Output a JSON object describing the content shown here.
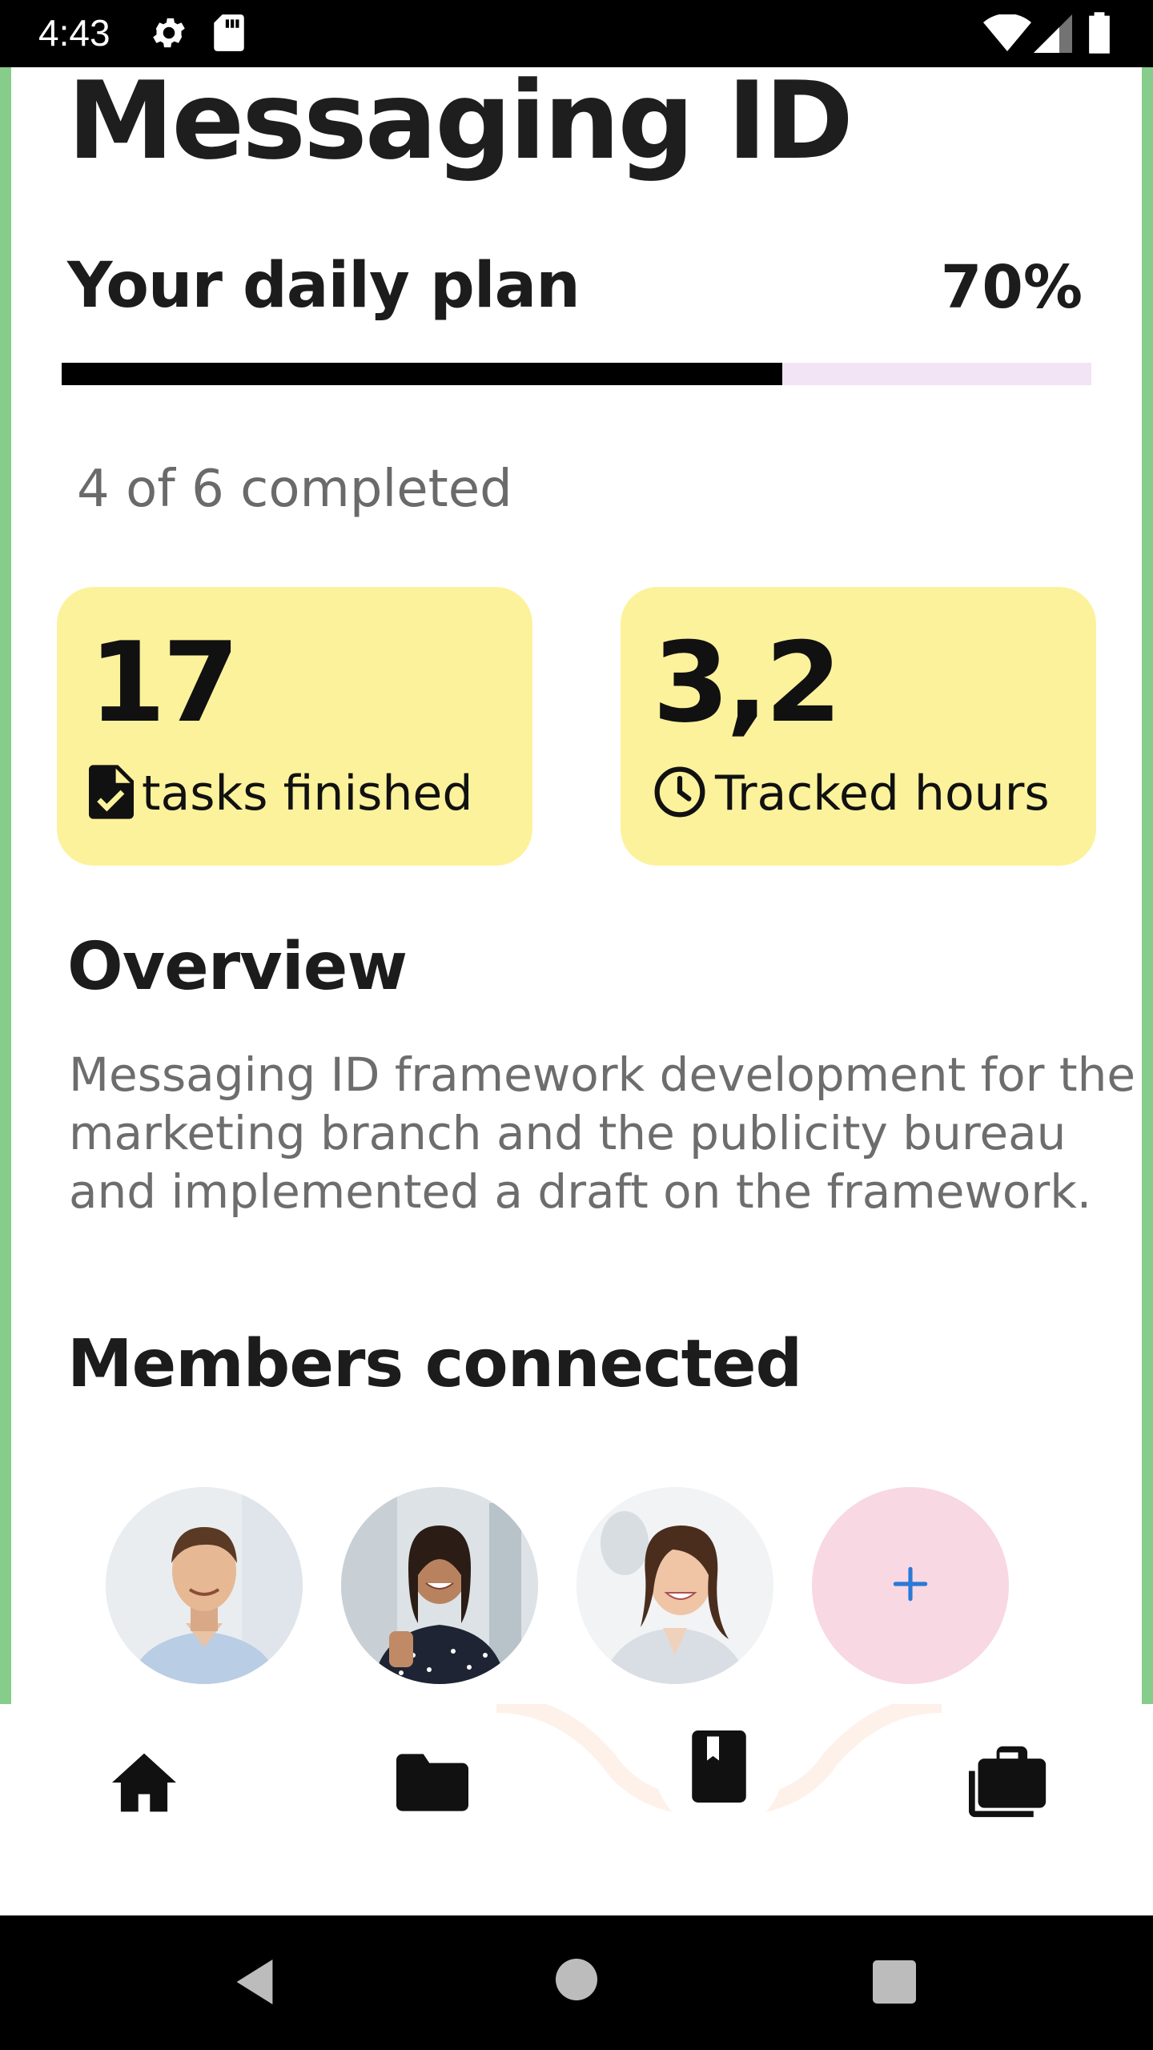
{
  "status_bar": {
    "time": "4:43",
    "icons": [
      "gear-icon",
      "sd-card-icon",
      "wifi-icon",
      "signal-icon",
      "battery-icon"
    ]
  },
  "header": {
    "title": "Messaging ID"
  },
  "plan": {
    "label": "Your daily plan",
    "percent_text": "70%",
    "progress": 0.7,
    "completed_text": "4 of 6 completed"
  },
  "stats": [
    {
      "value": "17",
      "label": "tasks finished",
      "icon": "task-done-icon"
    },
    {
      "value": "3,2",
      "label": "Tracked hours",
      "icon": "clock-icon"
    }
  ],
  "overview": {
    "heading": "Overview",
    "body": "Messaging ID framework development for the marketing branch and the publicity bureau and implemented a draft on the framework."
  },
  "members": {
    "heading": "Members connected",
    "avatars": [
      "avatar-man-blue-shirt",
      "avatar-woman-thumbs-up",
      "avatar-woman-smiling"
    ],
    "add_icon": "plus-icon"
  },
  "bottom_nav": [
    "home-icon",
    "folder-icon",
    "bookmark-icon",
    "briefcase-icon"
  ],
  "system_nav": [
    "back-icon",
    "home-circle-icon",
    "recents-icon"
  ],
  "colors": {
    "side_border": "#86cc8a",
    "stat_card": "#fcf29c",
    "progress_track": "#f2e3f5",
    "add_button": "#f8d8e3",
    "add_icon": "#2a7ad6"
  }
}
